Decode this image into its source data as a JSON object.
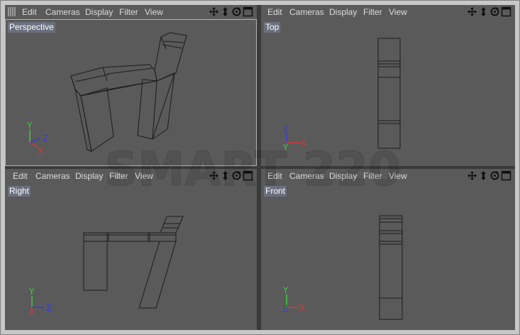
{
  "menu": {
    "edit": "Edit",
    "cameras": "Cameras",
    "display": "Display",
    "filter": "Filter",
    "view": "View"
  },
  "viewports": {
    "perspective": "Perspective",
    "top": "Top",
    "right": "Right",
    "front": "Front"
  },
  "axes": {
    "x": "X",
    "y": "Y",
    "z": "Z"
  },
  "watermark": "SMART 220",
  "colors": {
    "viewport_bg": "#5a5a5a",
    "wire": "#1c1c1c",
    "axis_x": "#d23b3b",
    "axis_y": "#3bcb3b",
    "axis_z": "#3b3bd8",
    "label_bg": "#6b7080"
  },
  "icons": [
    "move-icon",
    "dolly-icon",
    "rotate-icon",
    "maximize-icon"
  ]
}
